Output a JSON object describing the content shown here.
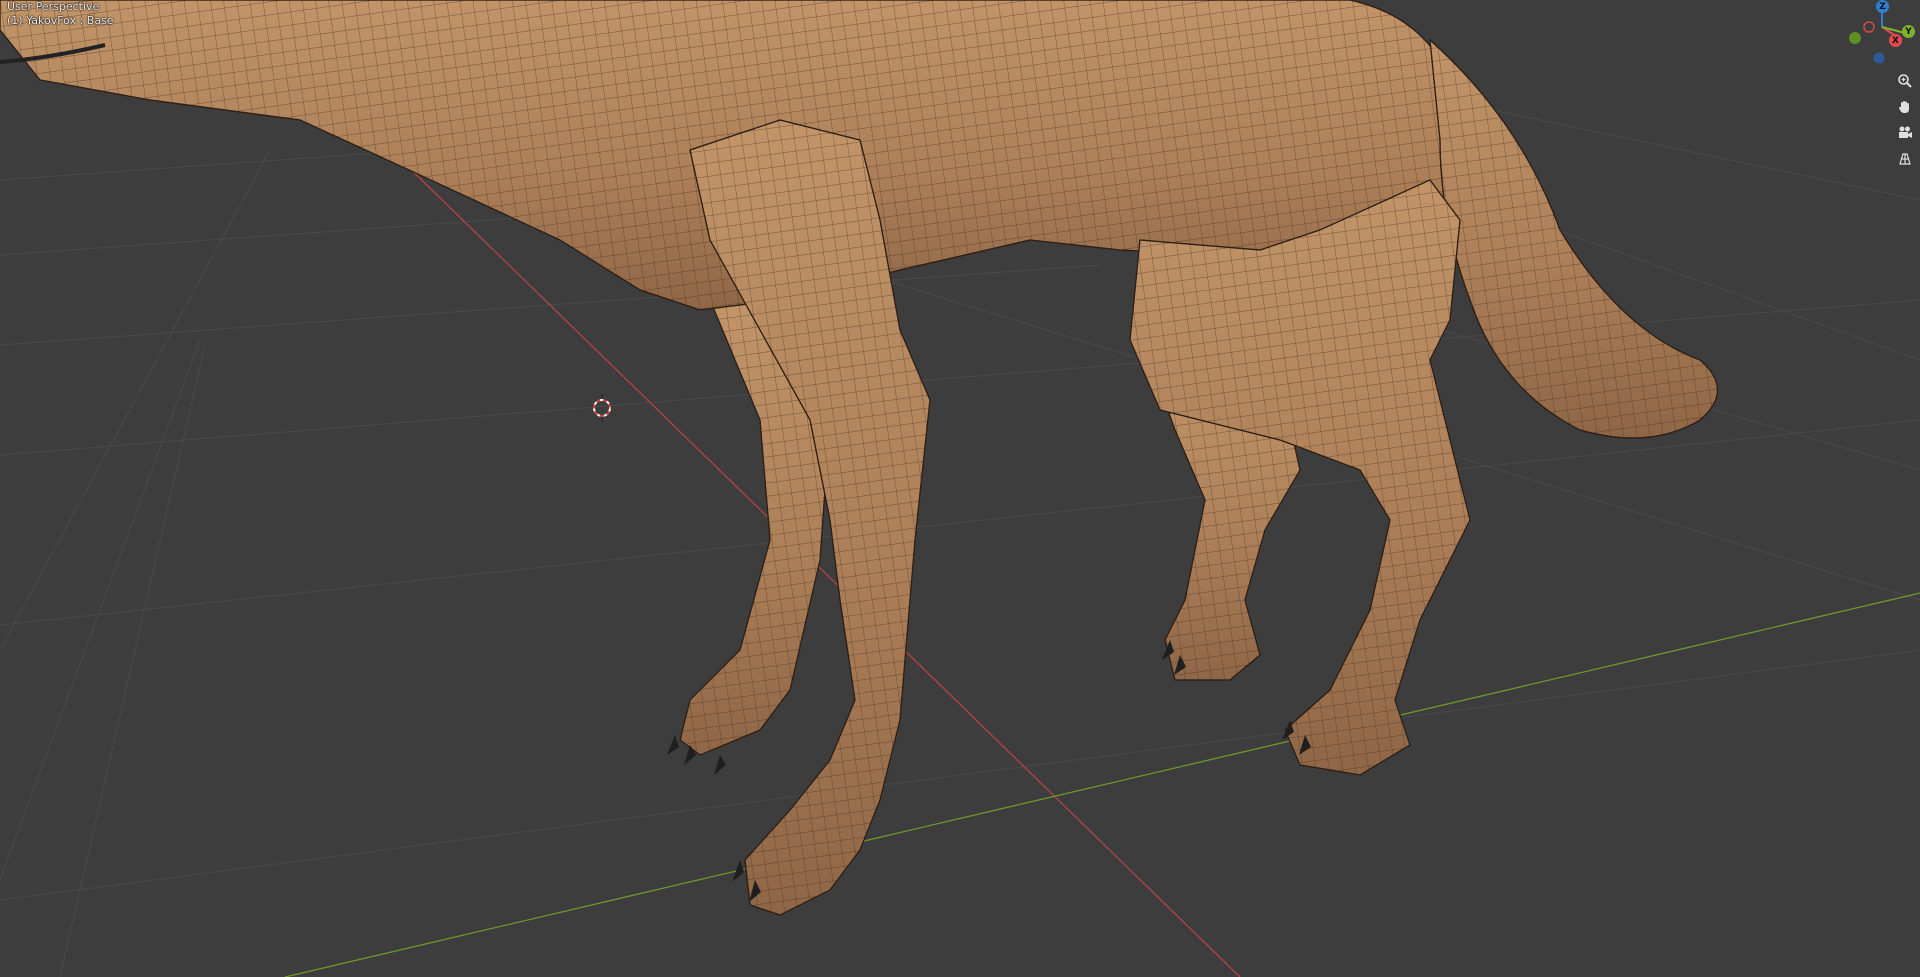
{
  "viewport": {
    "view_label": "User Perspective",
    "object_label": "(1) YakovFox : Base"
  },
  "gizmo": {
    "x_label": "X",
    "y_label": "Y",
    "z_label": "Z",
    "colors": {
      "x": "#e5484d",
      "y": "#7fb22a",
      "z": "#2f7fd4"
    }
  },
  "nav_icons": [
    "zoom-icon",
    "hand-pan-icon",
    "camera-icon",
    "grid-icon"
  ],
  "colors": {
    "background": "#3d3d3d",
    "grid": "#4a4a4a",
    "x_axis": "#b54247",
    "y_axis": "#6d962f",
    "model_fill": "#b0825a",
    "wire": "#3a2a1c"
  }
}
